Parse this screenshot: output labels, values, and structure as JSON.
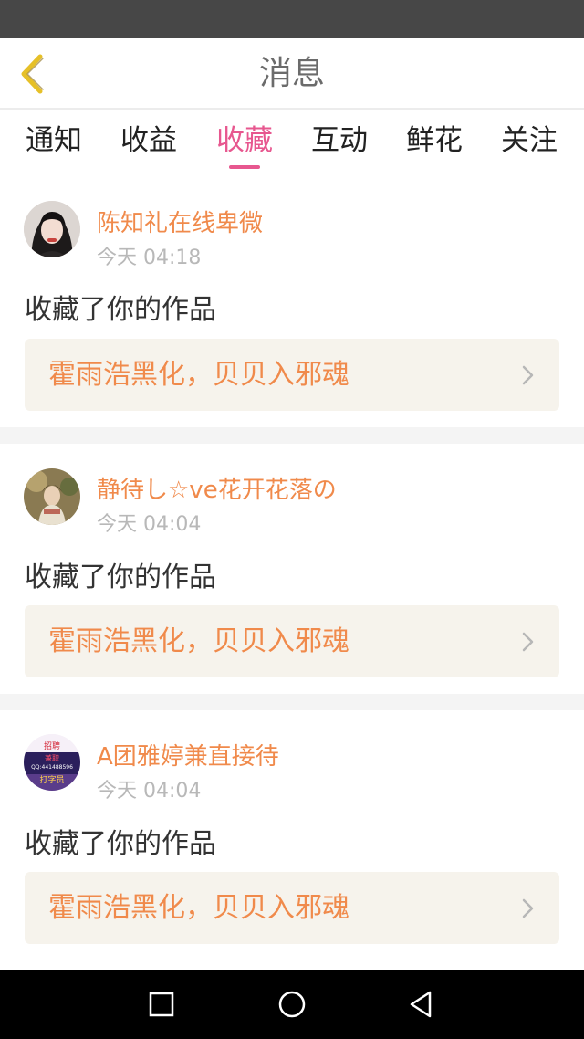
{
  "header": {
    "title": "消息",
    "back_icon": "chevron-left-icon",
    "back_color": "#e6c028"
  },
  "tabs": [
    {
      "label": "通知",
      "active": false
    },
    {
      "label": "收益",
      "active": false
    },
    {
      "label": "收藏",
      "active": true
    },
    {
      "label": "互动",
      "active": false
    },
    {
      "label": "鲜花",
      "active": false
    },
    {
      "label": "关注",
      "active": false
    }
  ],
  "colors": {
    "accent": "#e7578f",
    "username": "#f08a4b",
    "work_box_bg": "#f6f3ec"
  },
  "messages": [
    {
      "username": "陈知礼在线卑微",
      "time": "今天 04:18",
      "action": "收藏了你的作品",
      "work_title": "霍雨浩黑化，贝贝入邪魂"
    },
    {
      "username": "静待し☆ve花开花落の",
      "time": "今天 04:04",
      "action": "收藏了你的作品",
      "work_title": "霍雨浩黑化，贝贝入邪魂"
    },
    {
      "username": "A团雅婷兼直接待",
      "time": "今天 04:04",
      "action": "收藏了你的作品",
      "work_title": "霍雨浩黑化，贝贝入邪魂"
    }
  ],
  "avatar3_text": [
    "招聘",
    "兼职",
    "QQ:441488596",
    "打字员"
  ],
  "nav": {
    "recent_icon": "square-icon",
    "home_icon": "circle-icon",
    "back_icon": "triangle-back-icon"
  }
}
